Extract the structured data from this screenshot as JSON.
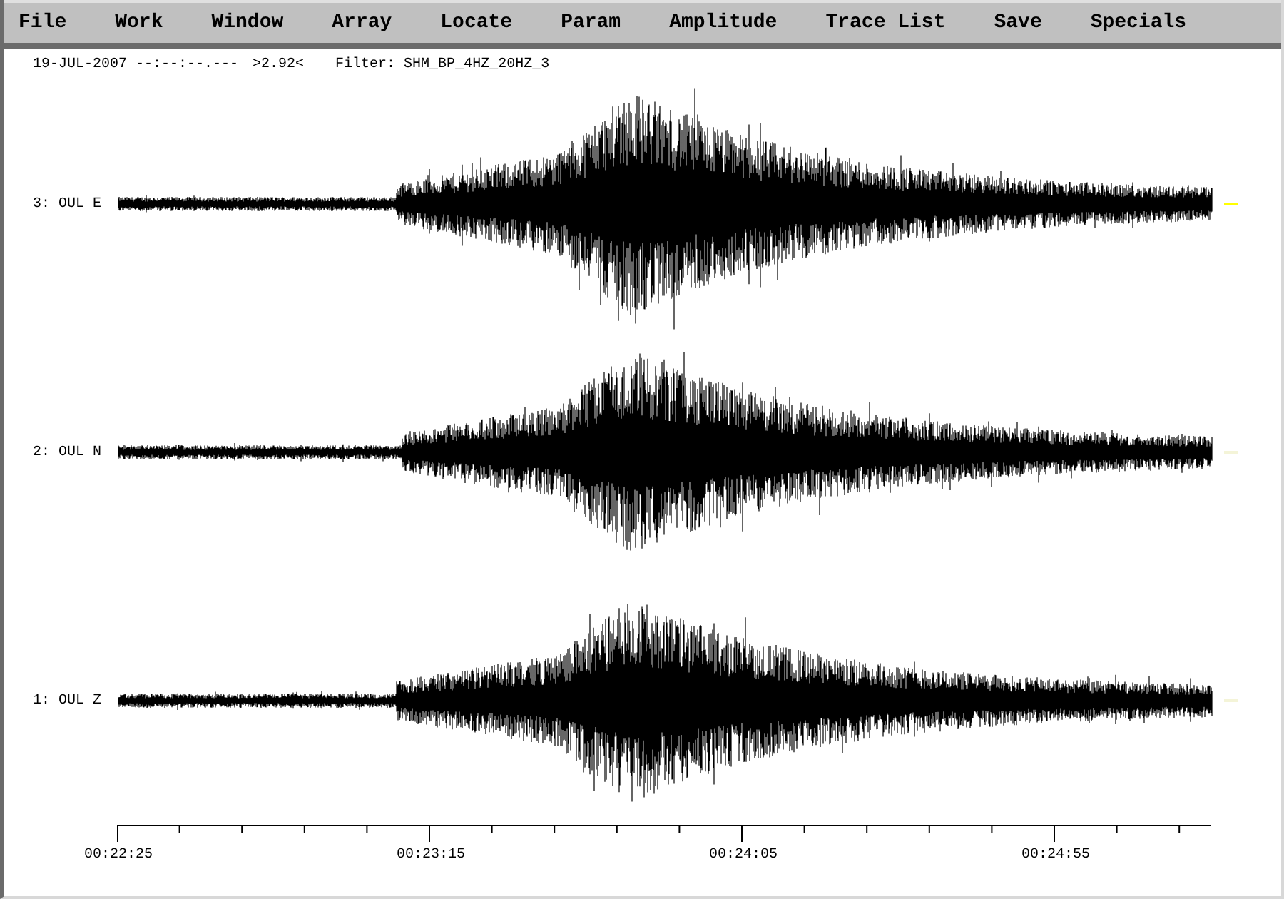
{
  "menu": [
    {
      "label": "File"
    },
    {
      "label": "Work"
    },
    {
      "label": "Window"
    },
    {
      "label": "Array"
    },
    {
      "label": "Locate"
    },
    {
      "label": "Param"
    },
    {
      "label": "Amplitude"
    },
    {
      "label": "Trace List"
    },
    {
      "label": "Save"
    },
    {
      "label": "Specials"
    }
  ],
  "header": {
    "date_time": "19-JUL-2007 --:--:--.---",
    "zoom": ">2.92<",
    "filter": "Filter: SHM_BP_4HZ_20HZ_3"
  },
  "traces": [
    {
      "label": "3: OUL E",
      "highlighted": true
    },
    {
      "label": "2: OUL N",
      "highlighted": false
    },
    {
      "label": "1: OUL Z",
      "highlighted": false
    }
  ],
  "time_axis": {
    "labels": [
      "00:22:25",
      "00:23:15",
      "00:24:05",
      "00:24:55"
    ]
  }
}
